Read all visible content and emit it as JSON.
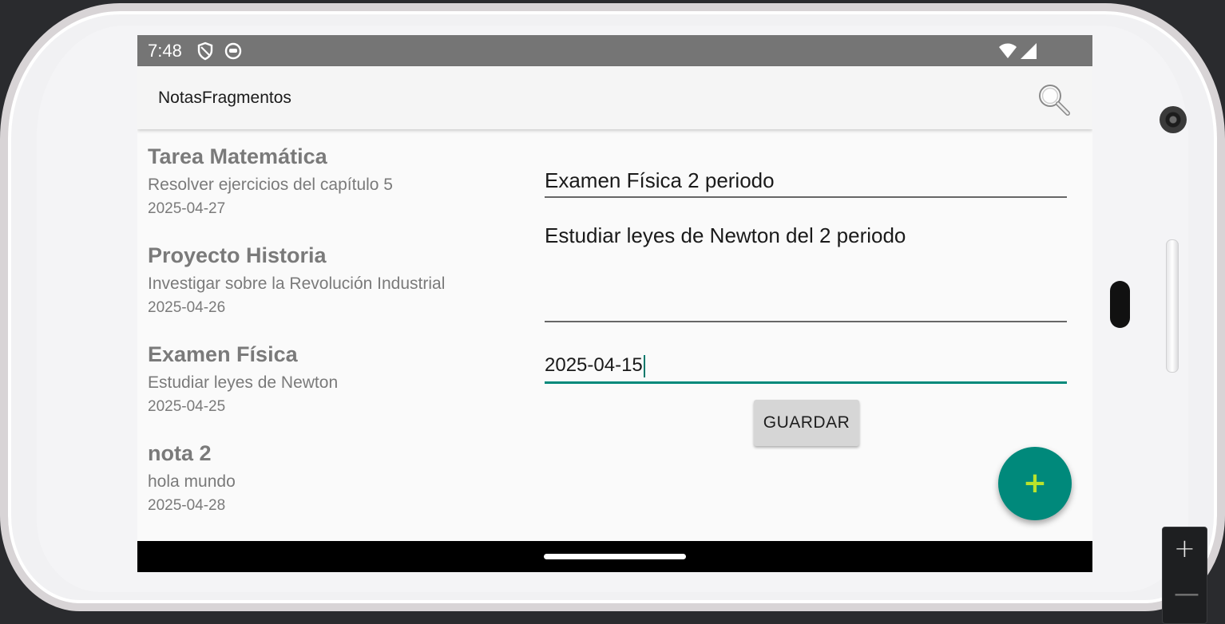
{
  "status_bar": {
    "time": "7:48",
    "icons": [
      "shield-icon",
      "notification-icon",
      "wifi-icon",
      "signal-icon"
    ]
  },
  "app_bar": {
    "title": "NotasFragmentos",
    "search_icon": "search-icon"
  },
  "notes": [
    {
      "title": "Tarea Matemática",
      "description": "Resolver ejercicios del capítulo 5",
      "date": "2025-04-27"
    },
    {
      "title": "Proyecto Historia",
      "description": "Investigar sobre la Revolución Industrial",
      "date": "2025-04-26"
    },
    {
      "title": "Examen Física",
      "description": "Estudiar leyes de Newton",
      "date": "2025-04-25"
    },
    {
      "title": "nota 2",
      "description": "hola mundo",
      "date": "2025-04-28"
    }
  ],
  "editor": {
    "title_value": "Examen Física 2 periodo",
    "body_value": "Estudiar leyes de Newton del 2 periodo",
    "date_value": "2025-04-15",
    "save_label": "GUARDAR"
  },
  "fab": {
    "icon": "plus-icon",
    "color": "#00897b"
  },
  "emulator": {
    "zoom_in": "+",
    "zoom_out": "—"
  },
  "colors": {
    "accent": "#00897b",
    "status_bar": "#757575"
  }
}
